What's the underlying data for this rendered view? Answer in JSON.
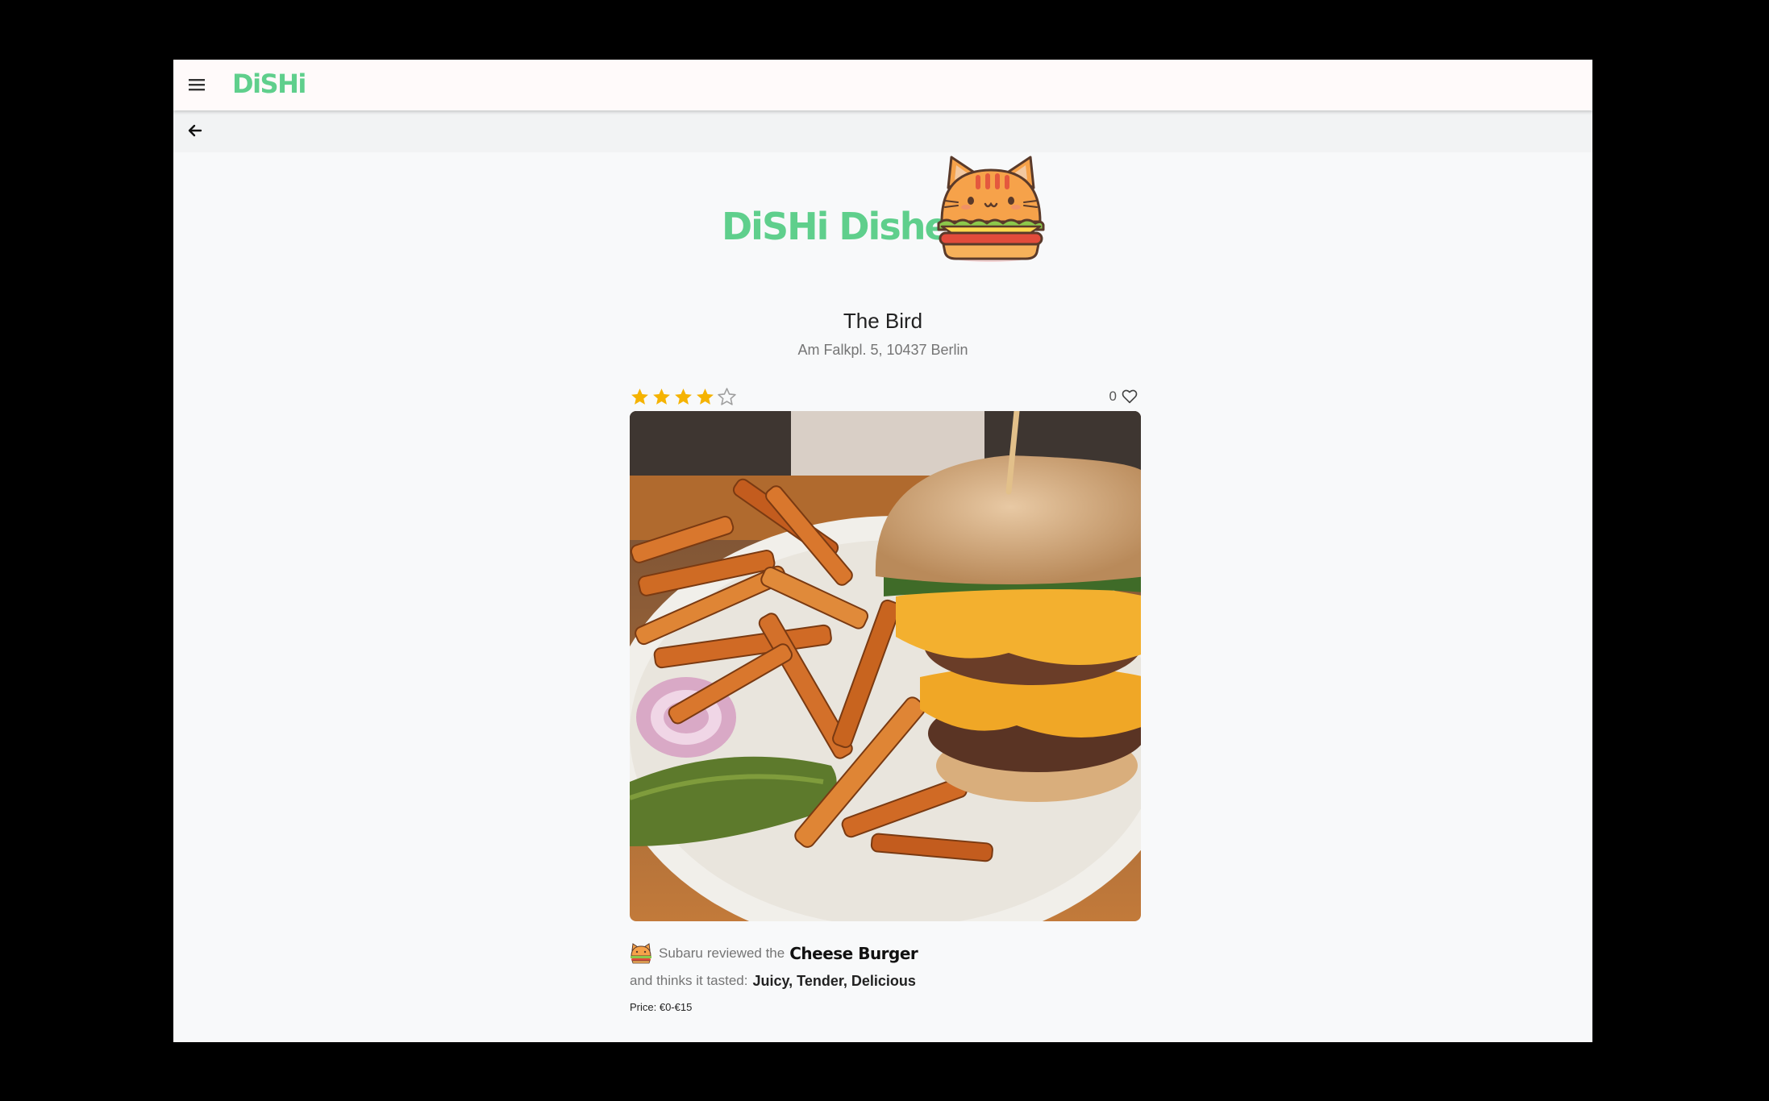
{
  "app": {
    "brand": "DiSHi"
  },
  "hero": {
    "title": "DiSHi Dishes!"
  },
  "restaurant": {
    "name": "The Bird",
    "address": "Am Falkpl. 5, 10437 Berlin"
  },
  "post": {
    "rating": 4,
    "rating_max": 5,
    "likes": "0",
    "reviewer": "Subaru",
    "reviewed_text": "reviewed the",
    "dish": "Cheese Burger",
    "thinks_text": "and thinks it tasted:",
    "tastes": "Juicy, Tender, Delicious",
    "price": "Price: €0-€15"
  },
  "icons": {
    "menu": "menu-icon",
    "back": "arrow-left-icon",
    "heart": "heart-outline-icon",
    "star": "star-icon"
  },
  "colors": {
    "brand_green": "#5fcf8c",
    "star_gold": "#f5b301",
    "page_bg": "#f8f9fa"
  }
}
